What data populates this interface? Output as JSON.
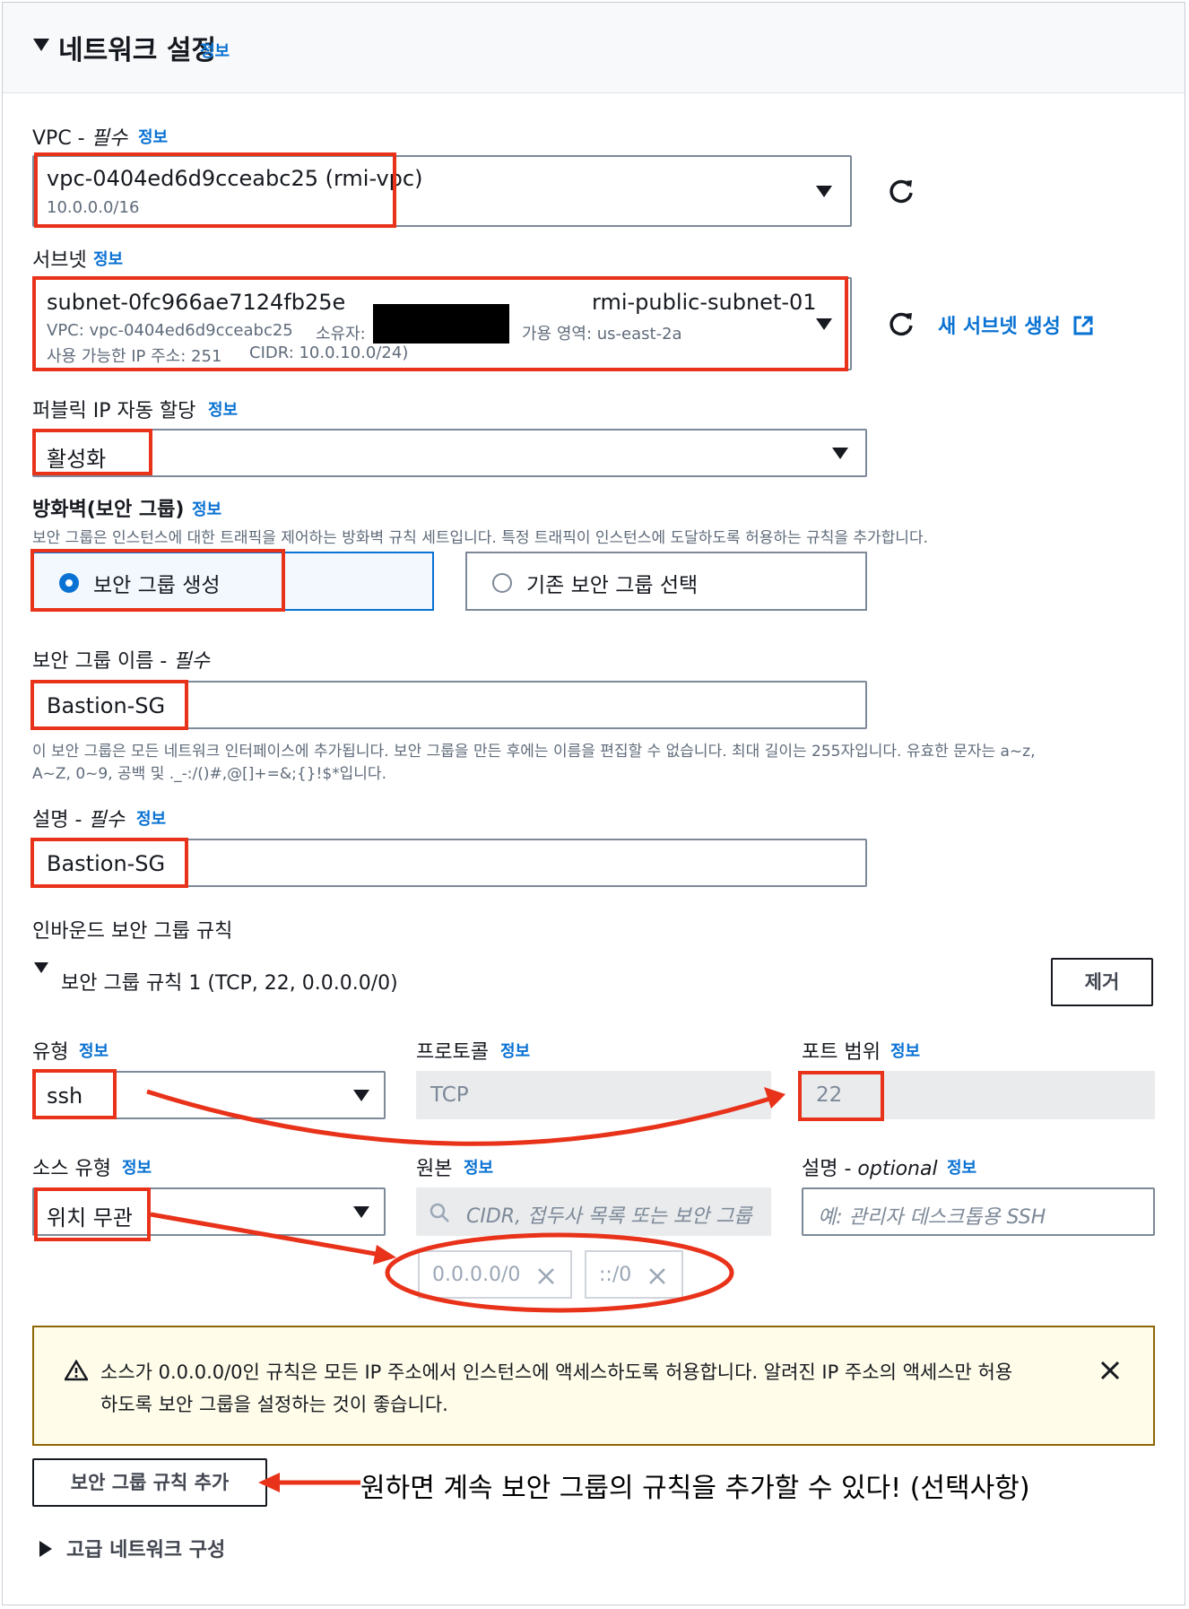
{
  "header": {
    "title": "네트워크 설정",
    "info": "정보"
  },
  "vpc": {
    "label": "VPC - ",
    "required": "필수",
    "info": "정보",
    "value": "vpc-0404ed6d9cceabc25 (rmi-vpc)",
    "cidr": "10.0.0.0/16"
  },
  "subnet": {
    "label": "서브넷",
    "info": "정보",
    "id": "subnet-0fc966ae7124fb25e",
    "name": "rmi-public-subnet-01",
    "vpc": "VPC: vpc-0404ed6d9cceabc25",
    "owner": "소유자:",
    "az": "가용 영역: us-east-2a",
    "available_ip": "사용 가능한 IP 주소: 251",
    "cidr": "CIDR: 10.0.10.0/24)",
    "create_link": "새 서브넷 생성"
  },
  "public_ip": {
    "label": "퍼블릭 IP 자동 할당",
    "info": "정보",
    "value": "활성화"
  },
  "firewall": {
    "label": "방화벽(보안 그룹)",
    "info": "정보",
    "description": "보안 그룹은 인스턴스에 대한 트래픽을 제어하는 방화벽 규칙 세트입니다. 특정 트래픽이 인스턴스에 도달하도록 허용하는 규칙을 추가합니다.",
    "option_create": "보안 그룹 생성",
    "option_existing": "기존 보안 그룹 선택"
  },
  "sg_name": {
    "label": "보안 그룹 이름 - ",
    "required": "필수",
    "value": "Bastion-SG",
    "hint_line1": "이 보안 그룹은 모든 네트워크 인터페이스에 추가됩니다. 보안 그룹을 만든 후에는 이름을 편집할 수 없습니다. 최대 길이는 255자입니다. 유효한 문자는 a~z,",
    "hint_line2": "A~Z, 0~9, 공백 및 ._-:/()#,@[]+=&;{}!$*입니다."
  },
  "description": {
    "label": "설명 - ",
    "required": "필수",
    "info": "정보",
    "value": "Bastion-SG"
  },
  "inbound": {
    "title": "인바운드 보안 그룹 규칙",
    "rule_title": "보안 그룹 규칙 1 (TCP, 22, 0.0.0.0/0)",
    "remove_button": "제거",
    "type_label": "유형",
    "type_info": "정보",
    "type_value": "ssh",
    "protocol_label": "프로토콜",
    "protocol_info": "정보",
    "protocol_value": "TCP",
    "port_label": "포트 범위",
    "port_info": "정보",
    "port_value": "22",
    "source_type_label": "소스 유형",
    "source_type_info": "정보",
    "source_type_value": "위치 무관",
    "source_label": "원본",
    "source_info": "정보",
    "source_placeholder": "CIDR, 접두사 목록 또는 보안 그룹",
    "chip1": "0.0.0.0/0",
    "chip2": "::/0",
    "desc_label": "설명 - ",
    "desc_optional": "optional",
    "desc_info": "정보",
    "desc_placeholder": "예: 관리자 데스크톱용 SSH"
  },
  "warning": {
    "line1": "소스가 0.0.0.0/0인 규칙은 모든 IP 주소에서 인스턴스에 액세스하도록 허용합니다. 알려진 IP 주소의 액세스만 허용",
    "line2": "하도록 보안 그룹을 설정하는 것이 좋습니다."
  },
  "add_rule_button": "보안 그룹 규칙 추가",
  "annotation": "원하면 계속 보안 그룹의 규칙을 추가할 수 있다! (선택사항)",
  "advanced": "고급 네트워크 구성",
  "colors": {
    "accent": "#0972d3",
    "annotation_red": "#e8321a",
    "warning_bg": "#fffce9",
    "warning_border": "#8d6605"
  }
}
